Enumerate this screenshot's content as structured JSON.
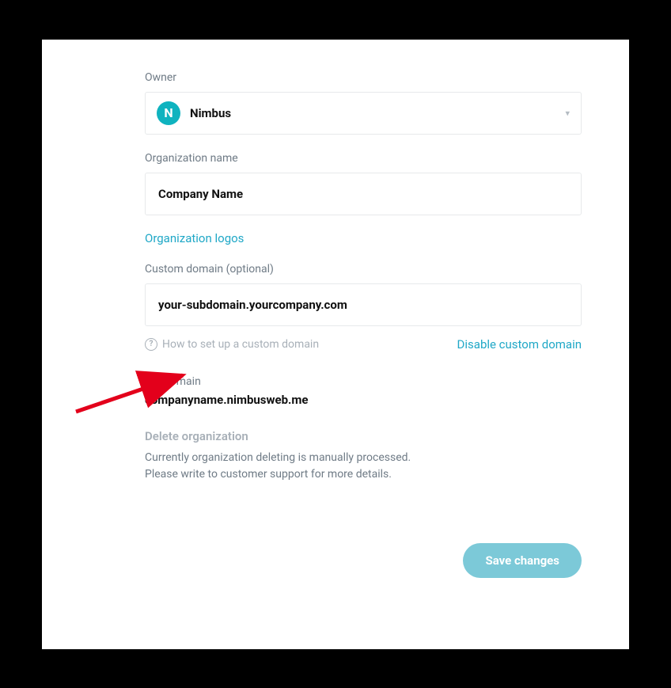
{
  "owner": {
    "label": "Owner",
    "avatar_letter": "N",
    "value": "Nimbus"
  },
  "org_name": {
    "label": "Organization name",
    "value": "Company Name"
  },
  "logos_link": "Organization logos",
  "custom_domain": {
    "label": "Custom domain (optional)",
    "value": "your-subdomain.yourcompany.com",
    "help_text": "How to set up a custom domain",
    "disable_text": "Disable custom domain"
  },
  "subdomain": {
    "label": "Subdomain",
    "value": "companyname.nimbusweb.me"
  },
  "delete_org": {
    "title": "Delete organization",
    "line1": "Currently organization deleting is manually processed.",
    "line2": "Please write to customer support for more details."
  },
  "save_button": "Save changes"
}
